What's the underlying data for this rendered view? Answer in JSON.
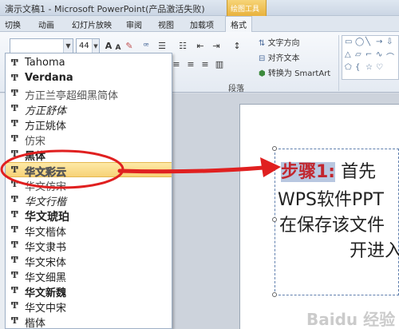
{
  "window": {
    "title": "演示文稿1 - Microsoft PowerPoint(产品激活失败)",
    "context_tab": "绘图工具"
  },
  "ribbon_tabs": [
    {
      "label": "切换"
    },
    {
      "label": "动画"
    },
    {
      "label": "幻灯片放映"
    },
    {
      "label": "审阅"
    },
    {
      "label": "视图"
    },
    {
      "label": "加载项"
    },
    {
      "label": "格式",
      "active": true
    }
  ],
  "toolbar": {
    "font_size": "44",
    "text_direction": "文字方向",
    "align_text": "对齐文本",
    "convert_smartart": "转换为 SmartArt",
    "paragraph_group": "段落"
  },
  "font_list": {
    "items": [
      {
        "name": "Tahoma"
      },
      {
        "name": "Verdana"
      },
      {
        "name": "方正兰亭超细黑简体"
      },
      {
        "name": "方正舒体"
      },
      {
        "name": "方正姚体"
      },
      {
        "name": "仿宋"
      },
      {
        "name": "黑体"
      },
      {
        "name": "华文彩云",
        "selected": true
      },
      {
        "name": "华文仿宋"
      },
      {
        "name": "华文行楷"
      },
      {
        "name": "华文琥珀"
      },
      {
        "name": "华文楷体"
      },
      {
        "name": "华文隶书"
      },
      {
        "name": "华文宋体"
      },
      {
        "name": "华文细黑"
      },
      {
        "name": "华文新魏"
      },
      {
        "name": "华文中宋"
      },
      {
        "name": "楷体"
      }
    ]
  },
  "slide": {
    "step_label": "步骤1:",
    "line1_rest": "首先",
    "line2": "WPS软件PPT",
    "line3": "在保存该文件",
    "line4": "开进入"
  },
  "watermark": "Baidu 经验",
  "colors": {
    "annotation_red": "#e02020",
    "selection_yellow": "#f7d277",
    "step_red": "#c2262e"
  }
}
